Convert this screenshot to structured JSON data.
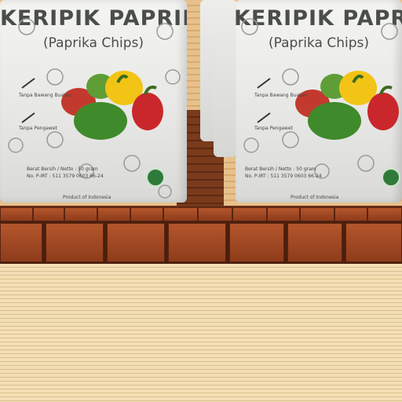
{
  "product": {
    "title": "KERIPIK PAPRIKA",
    "subtitle": "(Paprika Chips)",
    "net_weight": "Berat Bersih / Netto : 50 gram",
    "pirt": "No. P-IRT : 511 3579 0603 66-24",
    "origin": "Product of Indonesia",
    "claim1": "Tanpa Bawang Buatan",
    "claim2": "Tanpa Pengawet"
  },
  "colors": {
    "pack": "#eeeeec",
    "text": "#4a4e4a",
    "brick": "#a24a24",
    "floor": "#f3dfb4",
    "halal": "#2f7a3a"
  }
}
